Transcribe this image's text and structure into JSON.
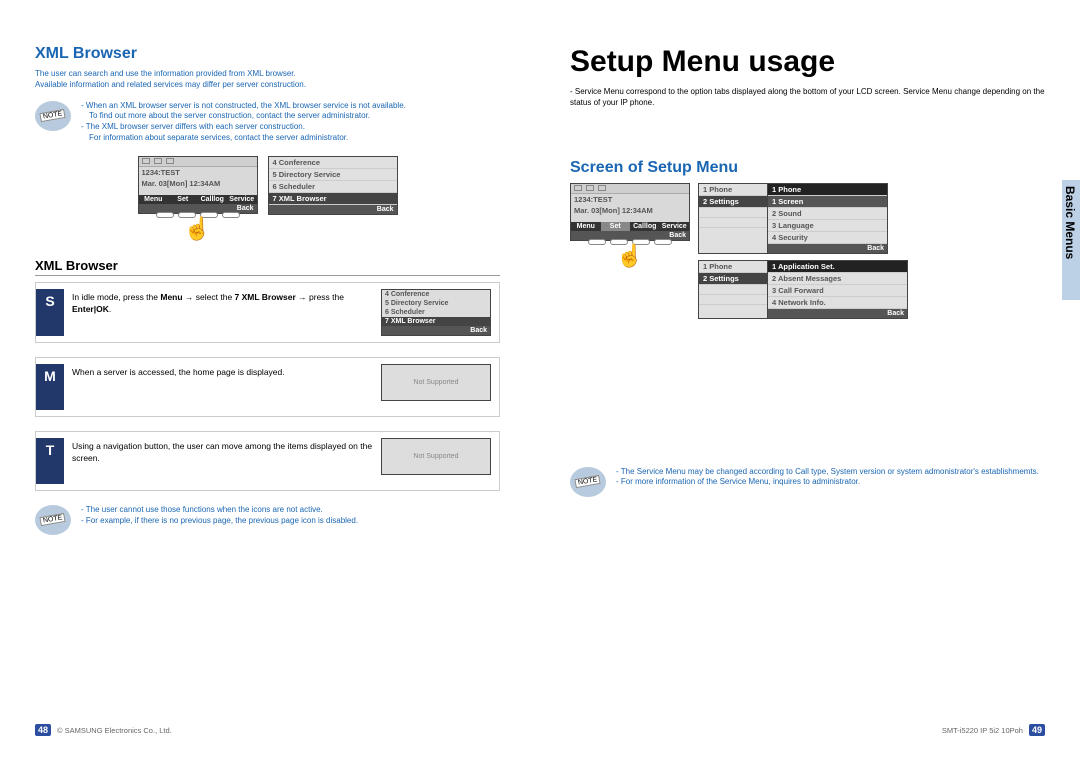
{
  "left": {
    "title": "XML Browser",
    "intro1": "The user can search and use the information provided from XML browser.",
    "intro2": "Available information and related services may differ per server construction.",
    "note1": {
      "l1": "When an XML browser server is not constructed, the XML browser service is not available.",
      "l2": "To find out more about the server construction, contact the server administrator.",
      "l3": "The XML browser server differs with each server construction.",
      "l4": "For information about separate services, contact the server administrator."
    },
    "idle_lcd": {
      "line1": "1234:TEST",
      "line2": "Mar. 03[Mon] 12:34AM",
      "soft": [
        "Menu",
        "Set",
        "Calllog",
        "Service"
      ],
      "back": "Back"
    },
    "menu_lcd": {
      "rows": [
        "4 Conference",
        "5 Directory Service",
        "6 Scheduler",
        "7 XML Browser"
      ],
      "selIndex": 3,
      "back": "Back"
    },
    "sub_heading": "XML Browser",
    "steps": {
      "s": {
        "letter": "S",
        "text_pre": "In idle mode, press the ",
        "b1": "Menu",
        "mid": " → select the ",
        "b2": "7 XML Browser",
        "mid2": " → press the ",
        "b3": "Enter|OK",
        "tail": "."
      },
      "m": {
        "letter": "M",
        "text": "When a server is accessed, the home page is displayed."
      },
      "t": {
        "letter": "T",
        "text": "Using a navigation button, the user can move among the items displayed on the screen."
      }
    },
    "mini_menu": {
      "rows": [
        "4 Conference",
        "5 Directory Service",
        "6 Scheduler",
        "7 XML Browser"
      ],
      "selIndex": 3,
      "back": "Back"
    },
    "ns": "Not Supported",
    "note2": {
      "l1": "The user cannot use those functions when the icons are not active.",
      "l2": "For example, if there is no previous page, the previous page icon is disabled."
    }
  },
  "right": {
    "title": "Setup Menu usage",
    "intro": "Service Menu correspond to the option tabs displayed along the bottom of your LCD screen. Service Menu change depending on the status of your IP phone.",
    "section": "Screen of Setup Menu",
    "sidetab": "Basic Menus",
    "idle_lcd": {
      "line1": "1234:TEST",
      "line2": "Mar. 03[Mon] 12:34AM",
      "soft": [
        "Menu",
        "Set",
        "Calllog",
        "Service"
      ],
      "back": "Back"
    },
    "set_menu": {
      "top": "1 Phone",
      "sel": "2 Settings",
      "sub": {
        "head": "1 Phone",
        "selRow": "1 Screen",
        "rows": [
          "2 Sound",
          "3 Language",
          "4 Security"
        ],
        "back": "Back"
      }
    },
    "set_menu2": {
      "left": {
        "r1": "1 Phone",
        "r2": "2 Settings"
      },
      "right": {
        "sel": "1 Application Set.",
        "rows": [
          "2 Absent Messages",
          "3 Call Forward",
          "4 Network Info."
        ],
        "back": "Back"
      }
    },
    "note": {
      "l1": "The Service Menu may be changed according to Call type, System version or system admonistrator's establishmemts.",
      "l2": "For more information of the Service Menu, inquires to administrator."
    }
  },
  "footer": {
    "left_num": "48",
    "right_num": "49",
    "left_txt": "© SAMSUNG Electronics Co., Ltd.",
    "right_txt": "SMT-i5220 IP 5i2 10Poh"
  }
}
